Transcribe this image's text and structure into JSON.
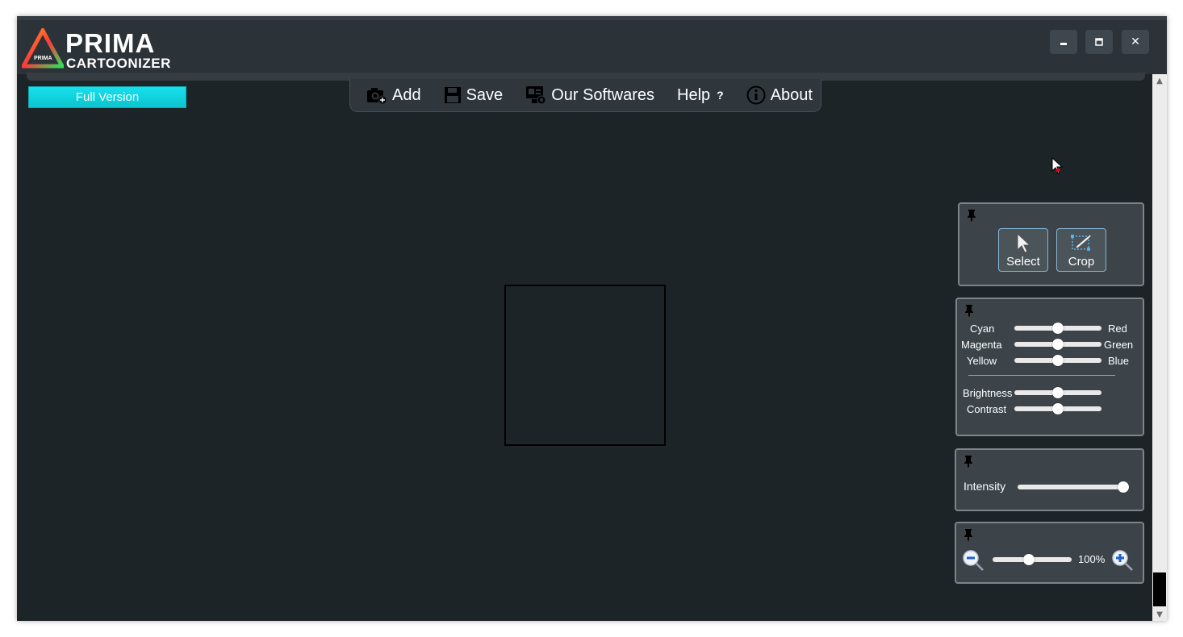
{
  "app": {
    "logo_line1": "PRIMA",
    "logo_line2": "CARTOONIZER",
    "logo_badge": "PRIMA"
  },
  "window_controls": {
    "minimize": "🗕",
    "maximize": "🗖",
    "close": "✕"
  },
  "full_version": "Full Version",
  "menu": {
    "add": "Add",
    "save": "Save",
    "softwares": "Our Softwares",
    "help": "Help",
    "help_q": "?",
    "about": "About"
  },
  "tools": {
    "select": "Select",
    "crop": "Crop"
  },
  "color_balance": {
    "rows": [
      {
        "left": "Cyan",
        "right": "Red",
        "value": 0.5
      },
      {
        "left": "Magenta",
        "right": "Green",
        "value": 0.5
      },
      {
        "left": "Yellow",
        "right": "Blue",
        "value": 0.5
      }
    ],
    "brightness": {
      "label": "Brightness",
      "value": 0.5
    },
    "contrast": {
      "label": "Contrast",
      "value": 0.5
    }
  },
  "intensity": {
    "label": "Intensity",
    "value": 1.0
  },
  "zoom": {
    "value_label": "100%",
    "value": 0.45
  },
  "colors": {
    "accent": "#0dd2dc",
    "background": "#1d2428",
    "panel": "#3c4449"
  }
}
